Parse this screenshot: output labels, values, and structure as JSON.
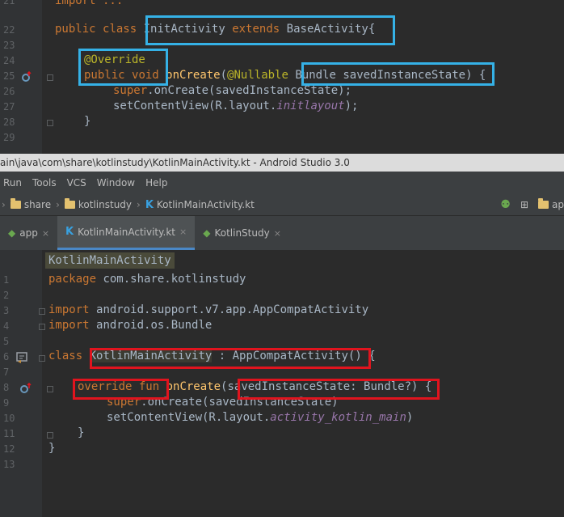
{
  "java_editor": {
    "line_numbers": [
      "21",
      "22",
      "23",
      "24",
      "25",
      "26",
      "27",
      "28",
      "29"
    ],
    "line21": "import ...",
    "line22_public": "public",
    "line22_class": "class",
    "line22_name": "InitActivity",
    "line22_extends": "extends",
    "line22_base": "BaseActivity",
    "line22_brace": "{",
    "line24_override": "@Override",
    "line25_public": "public",
    "line25_void": "void",
    "line25_method": "onCreate",
    "line25_paren": "(",
    "line25_nullable": "@Nullable",
    "line25_param": "Bundle savedInstanceState",
    "line25_end": ") {",
    "line26_super": "super",
    "line26_rest": ".onCreate(savedInstanceState);",
    "line27_call": "setContentView(R.layout.",
    "line27_layout": "initlayout",
    "line27_end": ");",
    "line28": "}"
  },
  "window": {
    "title": "ain\\java\\com\\share\\kotlinstudy\\KotlinMainActivity.kt - Android Studio 3.0"
  },
  "menu": {
    "items": [
      "Run",
      "Tools",
      "VCS",
      "Window",
      "Help"
    ]
  },
  "breadcrumb": {
    "items": [
      "share",
      "kotlinstudy",
      "KotlinMainActivity.kt"
    ],
    "right_label": "ap"
  },
  "tabs": [
    {
      "label": "app"
    },
    {
      "label": "KotlinMainActivity.kt"
    },
    {
      "label": "KotlinStudy"
    }
  ],
  "kotlin_editor": {
    "class_label": "KotlinMainActivity",
    "line_numbers": [
      "1",
      "2",
      "3",
      "4",
      "5",
      "6",
      "7",
      "8",
      "9",
      "10",
      "11",
      "12",
      "13"
    ],
    "line1_package": "package",
    "line1_name": "com.share.kotlinstudy",
    "line3_import": "import",
    "line3_name": "android.support.v7.app.AppCompatActivity",
    "line4_import": "import",
    "line4_name": "android.os.Bundle",
    "line6_class": "class",
    "line6_name": "KotlinMainActivity",
    "line6_colon": ":",
    "line6_parent": "AppCompatActivity",
    "line6_end": "() {",
    "line8_override": "override fun",
    "line8_method": "onCreate",
    "line8_paren": "(",
    "line8_param": "savedInstanceState: Bundle?",
    "line8_end": ") {",
    "line9_super": "super",
    "line9_rest": ".onCreate(savedInstanceState)",
    "line10_call": "setContentView(R.layout.",
    "line10_layout": "activity_kotlin_main",
    "line10_end": ")",
    "line11": "}",
    "line12": "}"
  },
  "colors": {
    "highlight_blue": "#35b1e6",
    "highlight_red": "#e0141e",
    "keyword": "#cc7832",
    "annotation": "#bbb529",
    "function": "#ffc66d"
  }
}
